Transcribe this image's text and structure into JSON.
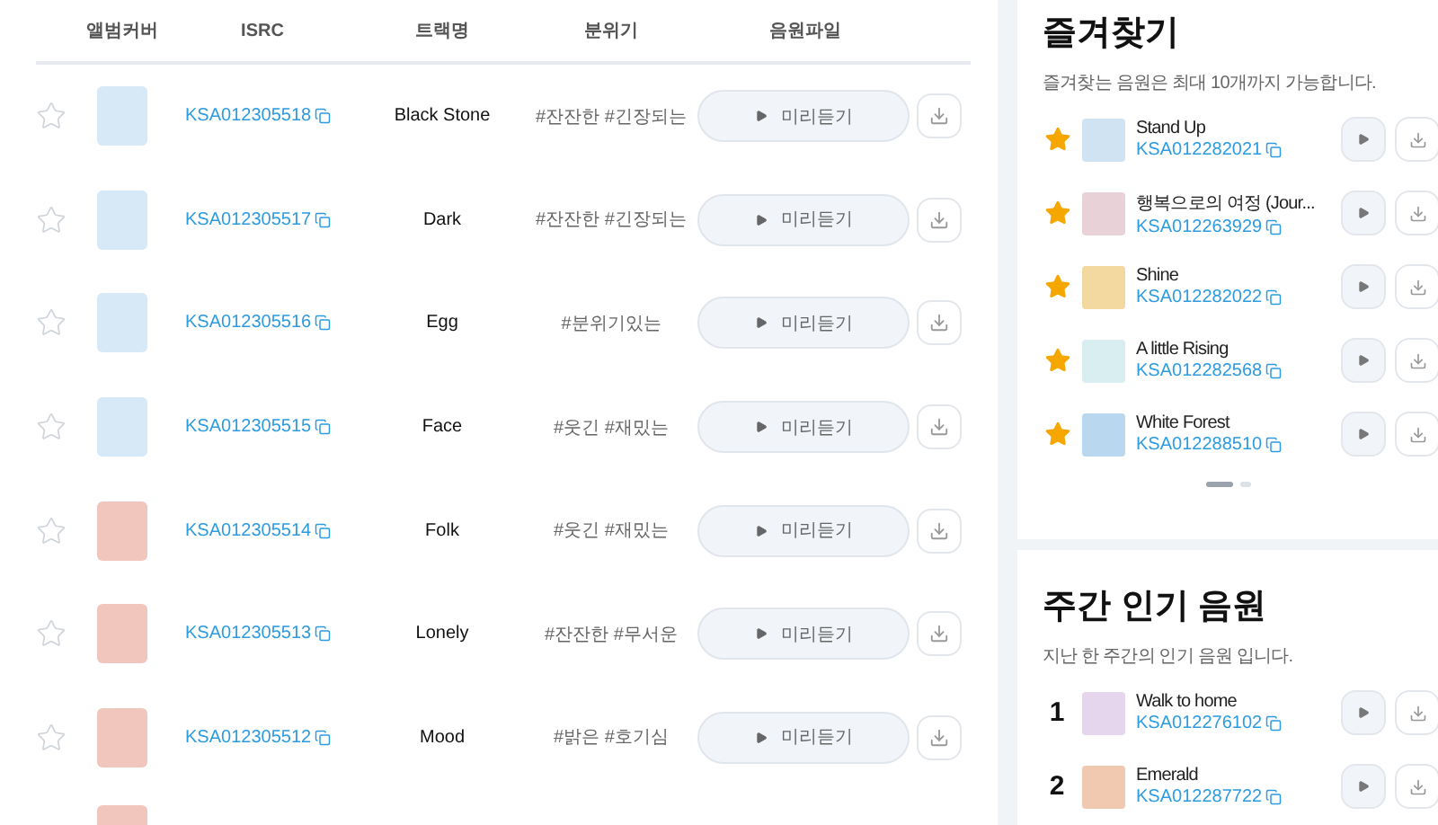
{
  "table": {
    "columns": [
      "앨범커버",
      "ISRC",
      "트랙명",
      "분위기",
      "음원파일"
    ],
    "rows": [
      {
        "kind": "full",
        "starred": false,
        "isrc": "KSA012305518",
        "track": "Black Stone",
        "mood": "#잔잔한 #긴장되는",
        "preview": "미리듣기"
      },
      {
        "kind": "full",
        "starred": false,
        "isrc": "KSA012305517",
        "track": "Dark",
        "mood": "#잔잔한 #긴장되는",
        "preview": "미리듣기"
      },
      {
        "kind": "full",
        "starred": false,
        "isrc": "KSA012305516",
        "track": "Egg",
        "mood": "#분위기있는",
        "preview": "미리듣기"
      },
      {
        "kind": "full",
        "starred": false,
        "isrc": "KSA012305515",
        "track": "Face",
        "mood": "#웃긴 #재밌는",
        "preview": "미리듣기"
      },
      {
        "kind": "full",
        "starred": false,
        "isrc": "KSA012305514",
        "track": "Folk",
        "mood": "#웃긴 #재밌는",
        "preview": "미리듣기"
      },
      {
        "kind": "full",
        "starred": false,
        "isrc": "KSA012305513",
        "track": "Lonely",
        "mood": "#잔잔한 #무서운",
        "preview": "미리듣기"
      },
      {
        "kind": "full",
        "starred": false,
        "isrc": "KSA012305512",
        "track": "Mood",
        "mood": "#밝은 #호기심",
        "preview": "미리듣기"
      },
      {
        "kind": "partial"
      }
    ]
  },
  "favorites": {
    "title": "즐겨찾기",
    "subtitle": "즐겨찾는 음원은 최대 10개까지 가능합니다.",
    "items": [
      {
        "starred": true,
        "title": "Stand Up",
        "isrc": "KSA012282021"
      },
      {
        "starred": true,
        "title": "행복으로의 여정 (Jour...",
        "isrc": "KSA012263929"
      },
      {
        "starred": true,
        "title": "Shine",
        "isrc": "KSA012282022"
      },
      {
        "starred": true,
        "title": "A little Rising",
        "isrc": "KSA012282568"
      },
      {
        "starred": true,
        "title": "White Forest",
        "isrc": "KSA012288510"
      }
    ],
    "pages": [
      {
        "selected": true
      },
      {
        "selected": false
      }
    ]
  },
  "weekly": {
    "title": "주간 인기 음원",
    "subtitle": "지난 한 주간의 인기 음원 입니다.",
    "items": [
      {
        "rank": "1",
        "title": "Walk to home",
        "isrc": "KSA012276102"
      },
      {
        "rank": "2",
        "title": "Emerald",
        "isrc": "KSA012287722"
      }
    ]
  }
}
